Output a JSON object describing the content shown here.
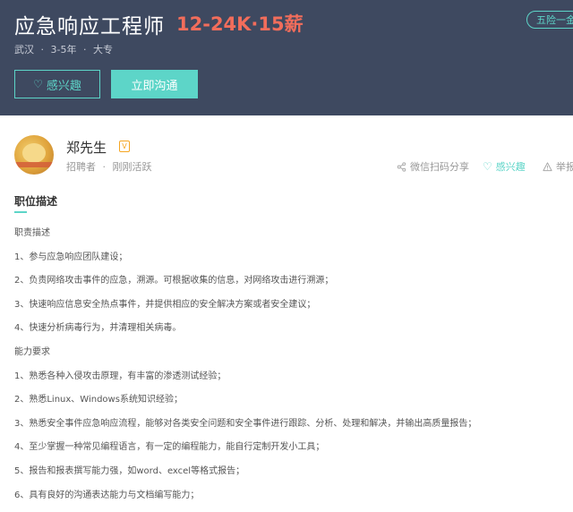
{
  "job": {
    "title": "应急响应工程师",
    "salary": "12-24K·15薪",
    "welfare_badge": "五险一金",
    "meta": [
      "武汉",
      "3-5年",
      "大专"
    ],
    "meta_sep": "·"
  },
  "buttons": {
    "interest": "感兴趣",
    "chat": "立即沟通"
  },
  "recruiter": {
    "name": "郑先生",
    "verify_icon_glyph": "V",
    "role": "招聘者",
    "role_sep": "·",
    "status": "刚刚活跃"
  },
  "actions": {
    "share": "微信扫码分享",
    "interest": "感兴趣",
    "report": "举报"
  },
  "description": {
    "section_title": "职位描述",
    "lines": [
      "职责描述",
      "1、参与应急响应团队建设；",
      "2、负责网络攻击事件的应急，溯源。可根据收集的信息，对网络攻击进行溯源；",
      "3、快速响应信息安全热点事件，并提供相应的安全解决方案或者安全建议；",
      "4、快速分析病毒行为，并清理相关病毒。",
      "能力要求",
      "1、熟悉各种入侵攻击原理，有丰富的渗透测试经验；",
      "2、熟悉Linux、Windows系统知识经验；",
      "3、熟悉安全事件应急响应流程，能够对各类安全问题和安全事件进行跟踪、分析、处理和解决，并输出高质量报告；",
      "4、至少掌握一种常见编程语言，有一定的编程能力，能自行定制开发小工具；",
      "5、报告和报表撰写能力强，如word、excel等格式报告；",
      "6、具有良好的沟通表达能力与文档编写能力；"
    ]
  },
  "colors": {
    "banner": "#3e4960",
    "accent": "#5dd5c8",
    "salary": "#f26d5b",
    "verify": "#f5a623"
  },
  "icons": {
    "interest": "heart-icon",
    "share": "share-icon",
    "report": "warning-icon",
    "verify": "verified-badge-icon"
  }
}
